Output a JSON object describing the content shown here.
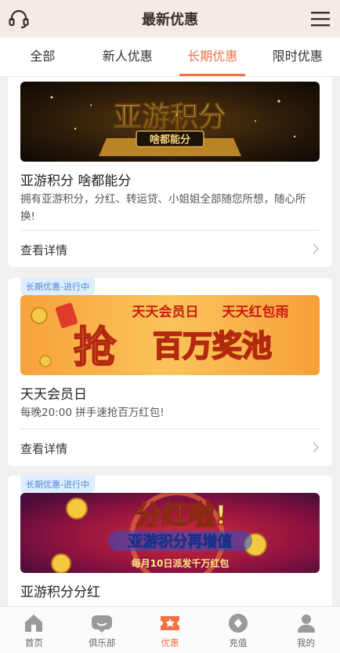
{
  "header": {
    "title": "最新优惠",
    "support_icon": "headset-icon",
    "menu_icon": "hamburger-menu-icon"
  },
  "tabs": [
    {
      "label": "全部"
    },
    {
      "label": "新人优惠"
    },
    {
      "label": "长期优惠",
      "active": true
    },
    {
      "label": "限时优惠"
    }
  ],
  "promotions": [
    {
      "banner_title": "亚游积分",
      "banner_subtitle": "啥都能分",
      "title": "亚游积分 啥都能分",
      "description": "拥有亚游积分，分红、转运贷、小姐姐全部随您所想，随心所换!",
      "details_label": "查看详情"
    },
    {
      "badge": "长期优惠-进行中",
      "banner_line1": "天天会员日",
      "banner_line1b": "天天红包雨",
      "banner_line2_big": "抢",
      "banner_line2": "百万奖池",
      "title": "天天会员日",
      "description": "每晚20:00 拼手速抢百万红包!",
      "details_label": "查看详情"
    },
    {
      "badge": "长期优惠-进行中",
      "banner_line1": "分红啦!",
      "banner_line2": "亚游积分再增值",
      "banner_line3": "每月10日派发千万红包",
      "title": "亚游积分分红"
    }
  ],
  "bottom_nav": [
    {
      "label": "首页",
      "icon": "home-icon"
    },
    {
      "label": "俱乐部",
      "icon": "chat-bubble-icon"
    },
    {
      "label": "优惠",
      "icon": "ticket-icon",
      "active": true
    },
    {
      "label": "充值",
      "icon": "diamond-coin-icon"
    },
    {
      "label": "我的",
      "icon": "user-icon"
    }
  ],
  "colors": {
    "accent": "#f07346",
    "badge_bg": "#ddeefe",
    "badge_text": "#4f87d7",
    "header_bg": "#f3ece6"
  }
}
